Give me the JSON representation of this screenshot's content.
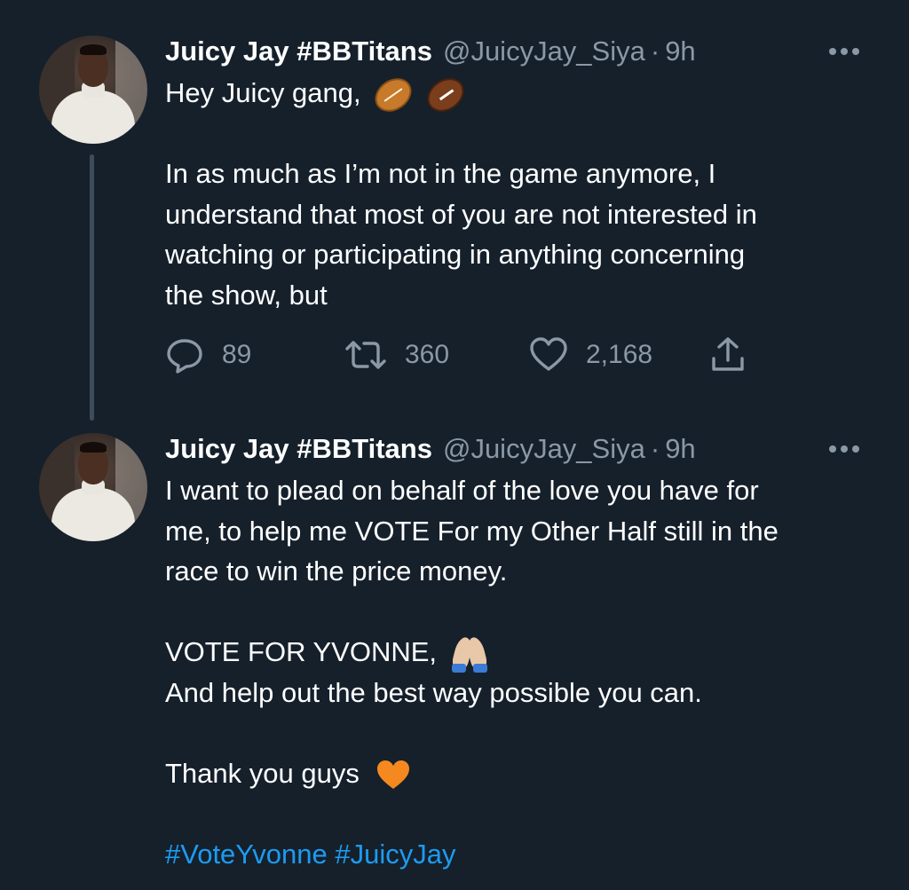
{
  "tweets": [
    {
      "author_name": "Juicy Jay #BBTitans",
      "handle": "@JuicyJay_Siya",
      "separator": "·",
      "time": "9h",
      "lines": [
        "Hey Juicy gang,",
        "",
        "In as much as I’m not in the game anymore, I",
        "understand that most of you are not interested in",
        "watching or participating in anything concerning",
        "the show, but"
      ],
      "emoji": [
        "rugby-ball-emoji",
        "american-football-emoji"
      ],
      "stats": {
        "replies": "89",
        "retweets": "360",
        "likes": "2,168"
      }
    },
    {
      "author_name": "Juicy Jay #BBTitans",
      "handle": "@JuicyJay_Siya",
      "separator": "·",
      "time": "9h",
      "lines": [
        "I want to plead on behalf of the love you have for",
        "me, to help me VOTE For my Other Half still in the",
        "race to win the price money.",
        "",
        "VOTE FOR YVONNE,",
        "And help out the best way possible you can.",
        "",
        "Thank you guys",
        "",
        "#VoteYvonne #JuicyJay"
      ],
      "emoji": [
        "folded-hands-emoji",
        "orange-heart-emoji"
      ]
    }
  ],
  "icons": {
    "reply": "reply-icon",
    "retweet": "retweet-icon",
    "like": "heart-icon",
    "share": "share-icon",
    "more": "more-icon"
  },
  "colors": {
    "background": "#15202b",
    "text": "#ffffff",
    "secondary": "#8b98a5",
    "link": "#1d9bf0",
    "thread_line": "#3d4c5a"
  }
}
